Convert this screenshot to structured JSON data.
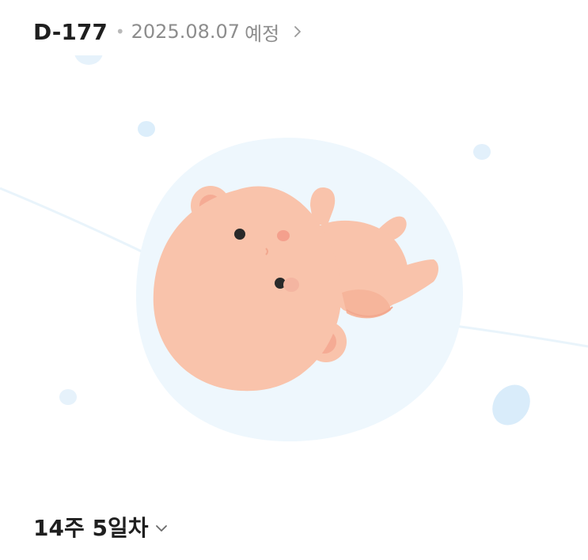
{
  "header": {
    "dday": "D-177",
    "separator": "•",
    "due_date": "2025.08.07",
    "due_label": "예정",
    "chevron_icon": "chevron-right-icon"
  },
  "illustration": {
    "subject": "baby-illustration",
    "colors": {
      "bubble": "#eef7fd",
      "bubble_dots": "#dceefb",
      "skin": "#f9c3ab",
      "skin_shade": "#f2a88f",
      "cheek": "#f4a08d",
      "line": "#e9f4fb"
    }
  },
  "week": {
    "label": "14주 5일차",
    "chevron_icon": "chevron-down-icon"
  }
}
